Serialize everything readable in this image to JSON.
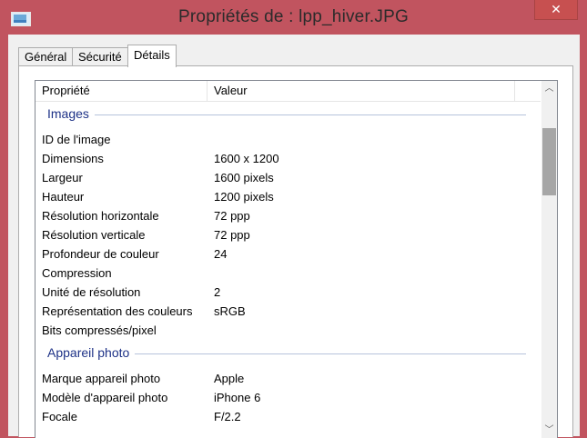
{
  "window": {
    "title": "Propriétés de : lpp_hiver.JPG",
    "close_glyph": "✕",
    "icon": "image-file-icon"
  },
  "tabs": [
    {
      "label": "Général",
      "active": false
    },
    {
      "label": "Sécurité",
      "active": false
    },
    {
      "label": "Détails",
      "active": true
    }
  ],
  "details": {
    "columns": {
      "property": "Propriété",
      "value": "Valeur"
    },
    "groups": [
      {
        "title": "Images",
        "rows": [
          {
            "property": "ID de l'image",
            "value": ""
          },
          {
            "property": "Dimensions",
            "value": "1600 x 1200"
          },
          {
            "property": "Largeur",
            "value": "1600 pixels"
          },
          {
            "property": "Hauteur",
            "value": "1200 pixels"
          },
          {
            "property": "Résolution horizontale",
            "value": "72 ppp"
          },
          {
            "property": "Résolution verticale",
            "value": "72 ppp"
          },
          {
            "property": "Profondeur de couleur",
            "value": "24"
          },
          {
            "property": "Compression",
            "value": ""
          },
          {
            "property": "Unité de résolution",
            "value": "2"
          },
          {
            "property": "Représentation des couleurs",
            "value": "sRGB"
          },
          {
            "property": "Bits compressés/pixel",
            "value": ""
          }
        ]
      },
      {
        "title": "Appareil photo",
        "rows": [
          {
            "property": "Marque appareil photo",
            "value": "Apple"
          },
          {
            "property": "Modèle d'appareil photo",
            "value": "iPhone 6"
          },
          {
            "property": "Focale",
            "value": "F/2.2"
          }
        ]
      }
    ]
  },
  "scrollbar": {
    "up_glyph": "︿",
    "down_glyph": "﹀",
    "position_fraction": 0.15
  },
  "colors": {
    "window_frame": "#c1545f",
    "close_button": "#c75050",
    "group_title": "#1e3287"
  }
}
